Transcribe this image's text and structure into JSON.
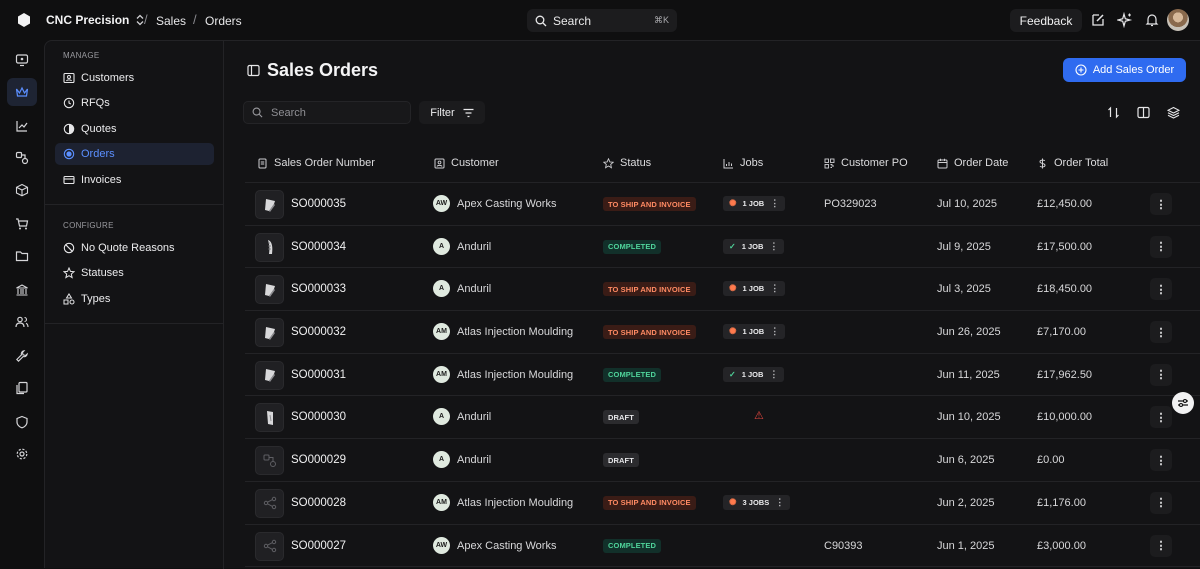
{
  "app": {
    "org_name": "CNC Precision"
  },
  "breadcrumb": {
    "section": "Sales",
    "page": "Orders"
  },
  "top_search": {
    "label": "Search",
    "shortcut": "⌘K"
  },
  "header_actions": {
    "feedback_label": "Feedback"
  },
  "rail": {
    "items": [
      "dashboard-icon",
      "sales-crown-icon",
      "chart-icon",
      "parts-icon",
      "cube-icon",
      "cart-icon",
      "folder-icon",
      "bank-icon",
      "users-icon",
      "wrench-icon",
      "documents-icon",
      "shield-icon",
      "settings-icon"
    ],
    "active": "sales-crown-icon"
  },
  "sidenav": {
    "manage_heading": "MANAGE",
    "manage_items": [
      {
        "label": "Customers",
        "icon": "contact-card-icon"
      },
      {
        "label": "RFQs",
        "icon": "clock-icon"
      },
      {
        "label": "Quotes",
        "icon": "half-circle-icon"
      },
      {
        "label": "Orders",
        "icon": "dot-circle-icon",
        "active": true
      },
      {
        "label": "Invoices",
        "icon": "card-icon"
      }
    ],
    "configure_heading": "CONFIGURE",
    "configure_items": [
      {
        "label": "No Quote Reasons",
        "icon": "ban-icon"
      },
      {
        "label": "Statuses",
        "icon": "star-icon"
      },
      {
        "label": "Types",
        "icon": "shapes-icon"
      }
    ]
  },
  "page": {
    "title": "Sales Orders",
    "add_button_label": "Add Sales Order",
    "search_placeholder": "Search",
    "filter_label": "Filter"
  },
  "table": {
    "columns": [
      "Sales Order Number",
      "Customer",
      "Status",
      "Jobs",
      "Customer PO",
      "Order Date",
      "Order Total"
    ],
    "rows": [
      {
        "thumb": "part",
        "number": "SO000035",
        "initials": "AW",
        "customer": "Apex Casting Works",
        "status": "TO SHIP AND INVOICE",
        "status_kind": "ship",
        "jobs": "1 JOB",
        "jobs_kind": "progress",
        "po": "PO329023",
        "date": "Jul 10, 2025",
        "total": "£12,450.00"
      },
      {
        "thumb": "part2",
        "number": "SO000034",
        "initials": "A",
        "customer": "Anduril",
        "status": "COMPLETED",
        "status_kind": "done",
        "jobs": "1 JOB",
        "jobs_kind": "done",
        "po": "",
        "date": "Jul 9, 2025",
        "total": "£17,500.00"
      },
      {
        "thumb": "part",
        "number": "SO000033",
        "initials": "A",
        "customer": "Anduril",
        "status": "TO SHIP AND INVOICE",
        "status_kind": "ship",
        "jobs": "1 JOB",
        "jobs_kind": "progress",
        "po": "",
        "date": "Jul 3, 2025",
        "total": "£18,450.00"
      },
      {
        "thumb": "part",
        "number": "SO000032",
        "initials": "AM",
        "customer": "Atlas Injection Moulding",
        "status": "TO SHIP AND INVOICE",
        "status_kind": "ship",
        "jobs": "1 JOB",
        "jobs_kind": "progress",
        "po": "",
        "date": "Jun 26, 2025",
        "total": "£7,170.00"
      },
      {
        "thumb": "part",
        "number": "SO000031",
        "initials": "AM",
        "customer": "Atlas Injection Moulding",
        "status": "COMPLETED",
        "status_kind": "done",
        "jobs": "1 JOB",
        "jobs_kind": "done",
        "po": "",
        "date": "Jun 11, 2025",
        "total": "£17,962.50"
      },
      {
        "thumb": "part3",
        "number": "SO000030",
        "initials": "A",
        "customer": "Anduril",
        "status": "DRAFT",
        "status_kind": "draft",
        "jobs": "",
        "jobs_kind": "warning",
        "po": "",
        "date": "Jun 10, 2025",
        "total": "£10,000.00"
      },
      {
        "thumb": "placeholder",
        "number": "SO000029",
        "initials": "A",
        "customer": "Anduril",
        "status": "DRAFT",
        "status_kind": "draft",
        "jobs": "",
        "jobs_kind": "none",
        "po": "",
        "date": "Jun 6, 2025",
        "total": "£0.00"
      },
      {
        "thumb": "placeholder2",
        "number": "SO000028",
        "initials": "AM",
        "customer": "Atlas Injection Moulding",
        "status": "TO SHIP AND INVOICE",
        "status_kind": "ship",
        "jobs": "3 JOBS",
        "jobs_kind": "progress",
        "po": "",
        "date": "Jun 2, 2025",
        "total": "£1,176.00"
      },
      {
        "thumb": "placeholder2",
        "number": "SO000027",
        "initials": "AW",
        "customer": "Apex Casting Works",
        "status": "COMPLETED",
        "status_kind": "done",
        "jobs": "",
        "jobs_kind": "none",
        "po": "C90393",
        "date": "Jun 1, 2025",
        "total": "£3,000.00"
      }
    ]
  },
  "colors": {
    "accent": "#2f6bf0",
    "ship": "#ff8a63",
    "done": "#4fd39a",
    "warn": "#e2463e"
  }
}
